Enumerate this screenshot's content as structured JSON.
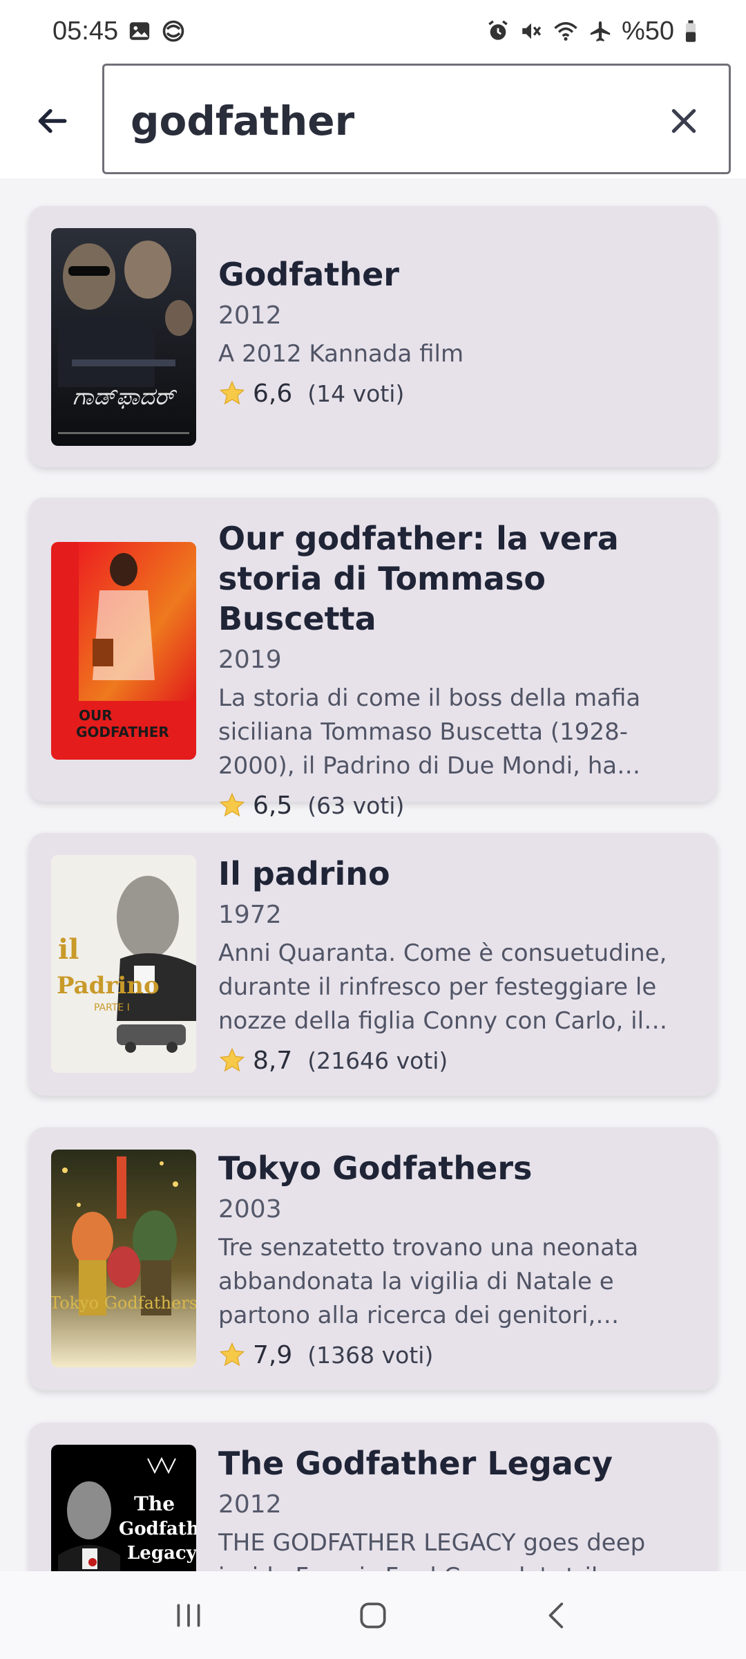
{
  "status_bar": {
    "time": "05:45",
    "battery": "%50"
  },
  "search": {
    "query": "godfather",
    "placeholder": ""
  },
  "results": [
    {
      "title": "Godfather",
      "year": "2012",
      "description": "A 2012 Kannada film",
      "rating": "6,6",
      "votes": "(14 voti)",
      "poster_colors": [
        "#1a1d24",
        "#5b6270"
      ]
    },
    {
      "title": "Our godfather: la vera storia di Tommaso Buscetta",
      "year": "2019",
      "description": "La storia di come il boss della mafia siciliana Tommaso Buscetta (1928-2000), il Padrino di Due Mondi, ha raccontato tutto.",
      "rating": "6,5",
      "votes": "(63 voti)",
      "poster_text_1": "OUR",
      "poster_text_2": "GODFATHER",
      "poster_colors": [
        "#e01d1d",
        "#f0a022"
      ]
    },
    {
      "title": "Il padrino",
      "year": "1972",
      "description": "Anni Quaranta. Come è consuetudine, durante il rinfresco per festeggiare le nozze della figlia Conny con Carlo, il \"padrino\" Don Vito Corleone riceve.",
      "rating": "8,7",
      "votes": "(21646 voti)",
      "poster_text_1": "il",
      "poster_text_2": "Padrino",
      "poster_text_3": "PARTE I",
      "poster_colors": [
        "#f2f0ec",
        "#8a8a88"
      ]
    },
    {
      "title": "Tokyo Godfathers",
      "year": "2003",
      "description": "Tre senzatetto trovano una neonata abbandonata la vigilia di Natale e partono alla ricerca dei genitori, incontrando molte persone.",
      "rating": "7,9",
      "votes": "(1368 voti)",
      "poster_text_1": "Tokyo Godfathers",
      "poster_colors": [
        "#2c3a22",
        "#f0e2b8"
      ]
    },
    {
      "title": "The Godfather Legacy",
      "year": "2012",
      "description": "THE GODFATHER LEGACY goes deep inside Francis Ford Coppola's trilogy.",
      "rating": "",
      "votes": "",
      "poster_text_1": "The",
      "poster_text_2": "Godfather",
      "poster_text_3": "Legacy",
      "poster_colors": [
        "#000000",
        "#ffffff"
      ]
    }
  ]
}
